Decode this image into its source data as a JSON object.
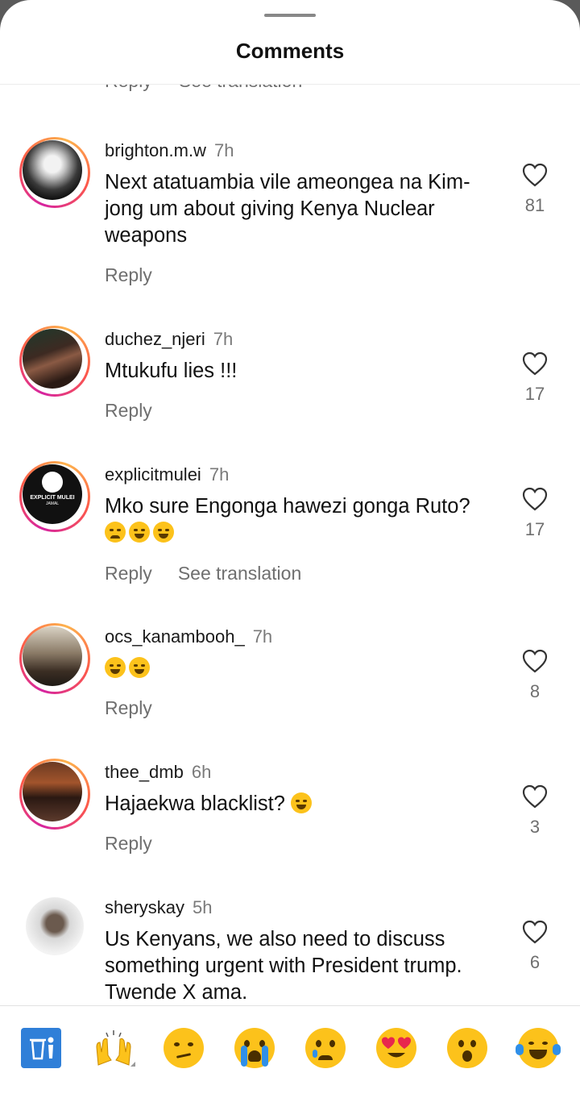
{
  "header": {
    "title": "Comments"
  },
  "partial_row": {
    "reply": "Reply",
    "translate": "See translation"
  },
  "labels": {
    "reply": "Reply",
    "see_translation": "See translation"
  },
  "comments": [
    {
      "user": "brighton.m.w",
      "time": "7h",
      "text": "Next atatuambia vile ameongea na Kim-jong um about giving Kenya Nuclear weapons",
      "likes": "81",
      "emoji": []
    },
    {
      "user": "duchez_njeri",
      "time": "7h",
      "text": "Mtukufu lies !!!",
      "likes": "17",
      "emoji": []
    },
    {
      "user": "explicitmulei",
      "time": "7h",
      "text": "Mko sure Engonga hawezi gonga Ruto?",
      "likes": "17",
      "emoji": [
        "crying-face",
        "tears-of-joy",
        "tears-of-joy"
      ],
      "avatar_text": [
        "EXPLICIT MULEI",
        "JAMAL"
      ]
    },
    {
      "user": "ocs_kanambooh_",
      "time": "7h",
      "text": "",
      "likes": "8",
      "emoji": [
        "tears-of-joy",
        "tears-of-joy"
      ]
    },
    {
      "user": "thee_dmb",
      "time": "6h",
      "text": "Hajaekwa blacklist?",
      "likes": "3",
      "emoji": [
        "tears-of-joy"
      ]
    },
    {
      "user": "sheryskay",
      "time": "5h",
      "text": "Us Kenyans, we also need to discuss something urgent with President trump. Twende X ama.",
      "likes": "6",
      "emoji": []
    }
  ],
  "reactions": [
    "trash-icon",
    "raising-hands",
    "smirking-face",
    "loudly-crying-face",
    "crying-face",
    "heart-eyes-face",
    "open-mouth-face",
    "tears-of-joy"
  ],
  "colors": {
    "accent_ring": "#d6249f",
    "muted_text": "#6f6f6f"
  }
}
